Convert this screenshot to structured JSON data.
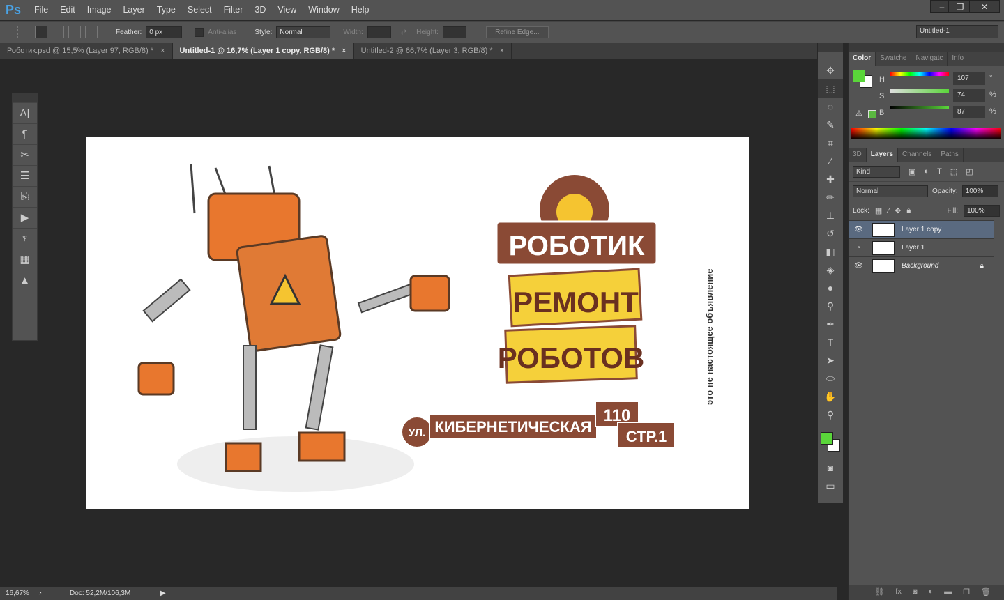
{
  "app": {
    "logo": "Ps",
    "menu": [
      "File",
      "Edit",
      "Image",
      "Layer",
      "Type",
      "Select",
      "Filter",
      "3D",
      "View",
      "Window",
      "Help"
    ],
    "window_buttons": [
      "–",
      "❐",
      "✕"
    ]
  },
  "options": {
    "feather_label": "Feather:",
    "feather_value": "0 px",
    "antialias_label": "Anti-alias",
    "style_label": "Style:",
    "style_value": "Normal",
    "width_label": "Width:",
    "height_label": "Height:",
    "refine_edge": "Refine Edge...",
    "workspace": "Untitled-1"
  },
  "tabs": [
    {
      "label": "Роботик.psd @ 15,5% (Layer 97, RGB/8) *",
      "active": false
    },
    {
      "label": "Untitled-1 @ 16,7% (Layer 1 copy, RGB/8) *",
      "active": true
    },
    {
      "label": "Untitled-2 @ 66,7% (Layer 3, RGB/8) *",
      "active": false
    }
  ],
  "color_panel": {
    "tabs": [
      "Color",
      "Swatche",
      "Navigatc",
      "Info"
    ],
    "h": "107",
    "s": "74",
    "b": "87",
    "h_unit": "°",
    "s_unit": "%",
    "b_unit": "%",
    "h_label": "H",
    "s_label": "S",
    "b_label": "B",
    "foreground": "#5ad63a",
    "background": "#ffffff"
  },
  "layers_panel": {
    "tabs": [
      "3D",
      "Layers",
      "Channels",
      "Paths"
    ],
    "kind": "Kind",
    "blend": "Normal",
    "opacity_label": "Opacity:",
    "opacity": "100%",
    "lock_label": "Lock:",
    "fill_label": "Fill:",
    "fill": "100%",
    "layers": [
      {
        "name": "Layer 1 copy",
        "visible": true,
        "selected": true
      },
      {
        "name": "Layer 1",
        "visible": false,
        "selected": false
      },
      {
        "name": "Background",
        "visible": true,
        "selected": false,
        "locked": true
      }
    ]
  },
  "artwork": {
    "title": "РОБОТИК",
    "line1": "РЕМОНТ",
    "line2": "РОБОТОВ",
    "street_prefix": "УЛ.",
    "street": "КИБЕРНЕТИЧЕСКАЯ",
    "number": "110",
    "building": "СТР.1",
    "vertical": "это не настоящее объявление"
  },
  "status": {
    "zoom": "16,67%",
    "doc": "Doc: 52,2M/106,3M"
  }
}
